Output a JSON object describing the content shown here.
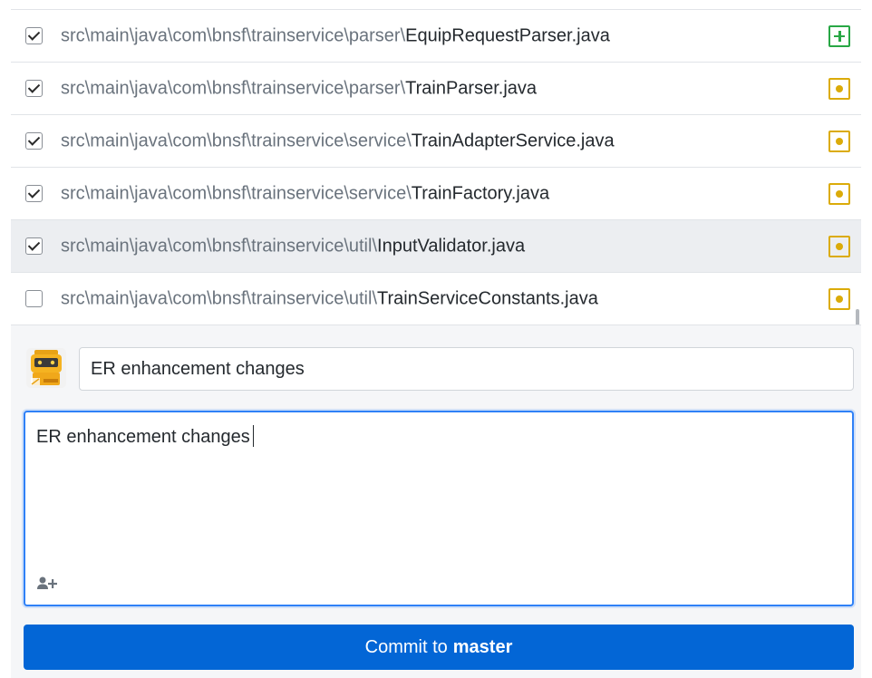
{
  "files": [
    {
      "dir": "src\\main\\java\\com\\bnsf\\trainservice\\parser\\",
      "name": "EquipRequestParser.java",
      "checked": true,
      "status": "added",
      "selected": false
    },
    {
      "dir": "src\\main\\java\\com\\bnsf\\trainservice\\parser\\",
      "name": "TrainParser.java",
      "checked": true,
      "status": "modified",
      "selected": false
    },
    {
      "dir": "src\\main\\java\\com\\bnsf\\trainservice\\service\\",
      "name": "TrainAdapterService.java",
      "checked": true,
      "status": "modified",
      "selected": false
    },
    {
      "dir": "src\\main\\java\\com\\bnsf\\trainservice\\service\\",
      "name": "TrainFactory.java",
      "checked": true,
      "status": "modified",
      "selected": false
    },
    {
      "dir": "src\\main\\java\\com\\bnsf\\trainservice\\util\\",
      "name": "InputValidator.java",
      "checked": true,
      "status": "modified",
      "selected": true
    },
    {
      "dir": "src\\main\\java\\com\\bnsf\\trainservice\\util\\",
      "name": "TrainServiceConstants.java",
      "checked": false,
      "status": "modified",
      "selected": false
    }
  ],
  "commit": {
    "summary": "ER enhancement changes",
    "description": "ER enhancement changes",
    "button_prefix": "Commit to",
    "branch": "master",
    "add_coauthor_icon": "add-person-icon",
    "avatar_icon": "robot-avatar-icon"
  },
  "colors": {
    "accent": "#0366d6",
    "added": "#28a745",
    "modified": "#dbab09",
    "focus": "#2f81f7"
  }
}
